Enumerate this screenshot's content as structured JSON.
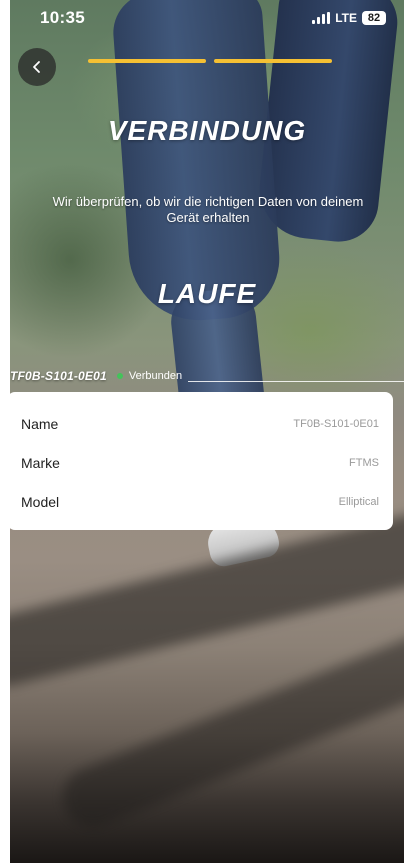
{
  "status_bar": {
    "time": "10:35",
    "network": "LTE",
    "battery": "82"
  },
  "progress": {
    "steps_total": 2,
    "steps_completed": 2,
    "color": "#f5c033"
  },
  "header": {
    "title": "VERBINDUNG",
    "subtitle": "Wir überprüfen, ob wir die richtigen Daten von deinem Gerät erhalten"
  },
  "activity": {
    "title": "LAUFE"
  },
  "device": {
    "id": "TF0B-S101-0E01",
    "status": "Verbunden",
    "status_color": "#43c35a"
  },
  "details": {
    "rows": [
      {
        "label": "Name",
        "value": "TF0B-S101-0E01"
      },
      {
        "label": "Marke",
        "value": "FTMS"
      },
      {
        "label": "Model",
        "value": "Elliptical"
      }
    ]
  },
  "icons": {
    "back": "chevron-left-icon",
    "signal": "signal-bars-icon",
    "battery": "battery-icon"
  }
}
